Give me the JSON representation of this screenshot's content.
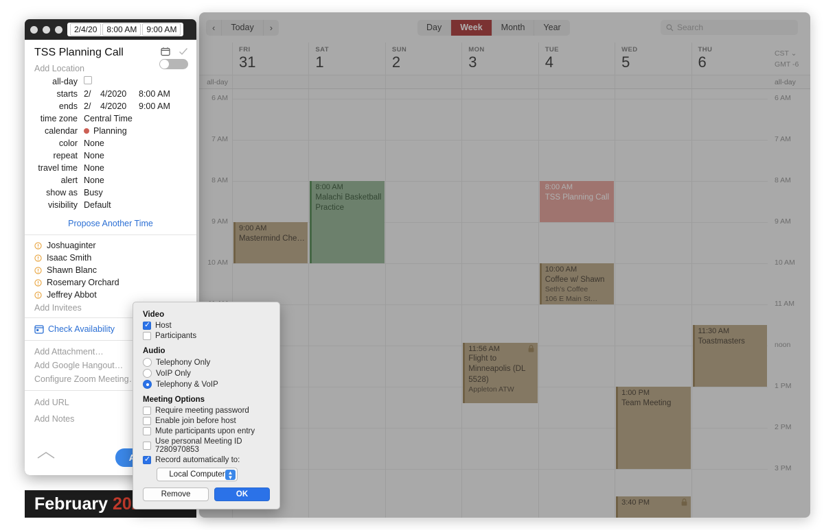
{
  "calendar_window": {
    "toolbar": {
      "prev_label": "‹",
      "today_label": "Today",
      "next_label": "›",
      "views": [
        {
          "label": "Day",
          "active": false
        },
        {
          "label": "Week",
          "active": true
        },
        {
          "label": "Month",
          "active": false
        },
        {
          "label": "Year",
          "active": false
        }
      ],
      "active_view_color": "#9f1b1b",
      "search_placeholder": "Search",
      "search_value": ""
    },
    "timezone": {
      "abbr": "CST ⌄",
      "offset": "GMT -6"
    },
    "allday_label": "all-day",
    "days": [
      {
        "dow": "FRI",
        "num": "31"
      },
      {
        "dow": "SAT",
        "num": "1"
      },
      {
        "dow": "SUN",
        "num": "2"
      },
      {
        "dow": "MON",
        "num": "3"
      },
      {
        "dow": "TUE",
        "num": "4"
      },
      {
        "dow": "WED",
        "num": "5"
      },
      {
        "dow": "THU",
        "num": "6"
      }
    ],
    "time_labels": [
      "6 AM",
      "7 AM",
      "8 AM",
      "9 AM",
      "10 AM",
      "11 AM",
      "noon",
      "1 PM",
      "2 PM",
      "3 PM"
    ],
    "events": [
      {
        "time": "9:00 AM",
        "title": "Mastermind Che…",
        "location": "",
        "day": 0,
        "start_hour": 9.0,
        "end_hour": 10.0,
        "bg": "#b09a74",
        "accent": "#8a6f3f",
        "text": "#2c2113",
        "locked": false
      },
      {
        "time": "8:00 AM",
        "title": "Malachi Basketball Practice",
        "location": "",
        "day": 1,
        "start_hour": 8.0,
        "end_hour": 10.0,
        "bg": "#83a883",
        "accent": "#3d7a3d",
        "text": "#1b3d1b",
        "locked": false
      },
      {
        "time": "11:56 AM",
        "title": "Flight to Minneapolis (DL 5528)",
        "location": "Appleton ATW",
        "day": 3,
        "start_hour": 11.93,
        "end_hour": 13.4,
        "bg": "#b09a74",
        "accent": "#8a6f3f",
        "text": "#2c2113",
        "locked": true
      },
      {
        "time": "8:00 AM",
        "title": "TSS Planning Call",
        "location": "",
        "day": 4,
        "start_hour": 8.0,
        "end_hour": 9.0,
        "bg": "#e09289",
        "accent": "#e09289",
        "text": "#ffffff",
        "locked": false
      },
      {
        "time": "10:00 AM",
        "title": "Coffee w/ Shawn",
        "location": "Seth's Coffee\n106 E Main St…",
        "day": 4,
        "start_hour": 10.0,
        "end_hour": 11.0,
        "bg": "#b09a74",
        "accent": "#8a6f3f",
        "text": "#2c2113",
        "locked": false
      },
      {
        "time": "1:00 PM",
        "title": "Team Meeting",
        "location": "",
        "day": 5,
        "start_hour": 13.0,
        "end_hour": 15.0,
        "bg": "#b09a74",
        "accent": "#8a6f3f",
        "text": "#2c2113",
        "locked": false
      },
      {
        "time": "3:40 PM",
        "title": "",
        "location": "",
        "day": 5,
        "start_hour": 15.67,
        "end_hour": 16.6,
        "bg": "#b09a74",
        "accent": "#8a6f3f",
        "text": "#2c2113",
        "locked": true
      },
      {
        "time": "11:30 AM",
        "title": "Toastmasters",
        "location": "",
        "day": 6,
        "start_hour": 11.5,
        "end_hour": 13.0,
        "bg": "#b09a74",
        "accent": "#8a6f3f",
        "text": "#2c2113",
        "locked": false
      }
    ]
  },
  "month_bar": {
    "month": "February",
    "year": "2020",
    "year_color": "#c0392b"
  },
  "editor": {
    "titlebar": {
      "date_value": "2/4/20",
      "start_value": "8:00 AM",
      "end_value": "9:00 AM"
    },
    "event_title": "TSS Planning Call",
    "location_placeholder": "Add Location",
    "fields": {
      "allday_label": "all-day",
      "allday_checked": false,
      "starts_label": "starts",
      "starts_month": "2/",
      "starts_day": "4/2020",
      "starts_time": "8:00 AM",
      "ends_label": "ends",
      "ends_month": "2/",
      "ends_day": "4/2020",
      "ends_time": "9:00 AM",
      "timezone_label": "time zone",
      "timezone_value": "Central Time",
      "calendar_label": "calendar",
      "calendar_value": "Planning",
      "calendar_color": "#cc6055",
      "color_label": "color",
      "color_value": "None",
      "repeat_label": "repeat",
      "repeat_value": "None",
      "travel_label": "travel time",
      "travel_value": "None",
      "alert_label": "alert",
      "alert_value": "None",
      "showas_label": "show as",
      "showas_value": "Busy",
      "visibility_label": "visibility",
      "visibility_value": "Default"
    },
    "propose_label": "Propose Another Time",
    "invitees": [
      "Joshuaginter",
      "Isaac Smith",
      "Shawn Blanc",
      "Rosemary Orchard",
      "Jeffrey Abbot"
    ],
    "add_invitees_label": "Add Invitees",
    "check_availability_label": "Check Availability",
    "attachment_links": [
      "Add Attachment…",
      "Add Google Hangout…",
      "Configure Zoom Meeting…"
    ],
    "url_label": "Add URL",
    "notes_label": "Add Notes",
    "add_event_label": "Add Event"
  },
  "zoom_popover": {
    "video_section": "Video",
    "video_options": [
      {
        "label": "Host",
        "checked": true
      },
      {
        "label": "Participants",
        "checked": false
      }
    ],
    "audio_section": "Audio",
    "audio_options": [
      {
        "label": "Telephony Only",
        "selected": false
      },
      {
        "label": "VoIP Only",
        "selected": false
      },
      {
        "label": "Telephony & VoIP",
        "selected": true
      }
    ],
    "meeting_section": "Meeting Options",
    "meeting_options": [
      {
        "label": "Require meeting password",
        "checked": false
      },
      {
        "label": "Enable join before host",
        "checked": false
      },
      {
        "label": "Mute participants upon entry",
        "checked": false
      },
      {
        "label": "Use personal Meeting ID 7280970853",
        "checked": false
      },
      {
        "label": "Record automatically to:",
        "checked": true
      }
    ],
    "record_target": "Local Computer",
    "remove_label": "Remove",
    "ok_label": "OK",
    "accent_color": "#2b72e8"
  }
}
